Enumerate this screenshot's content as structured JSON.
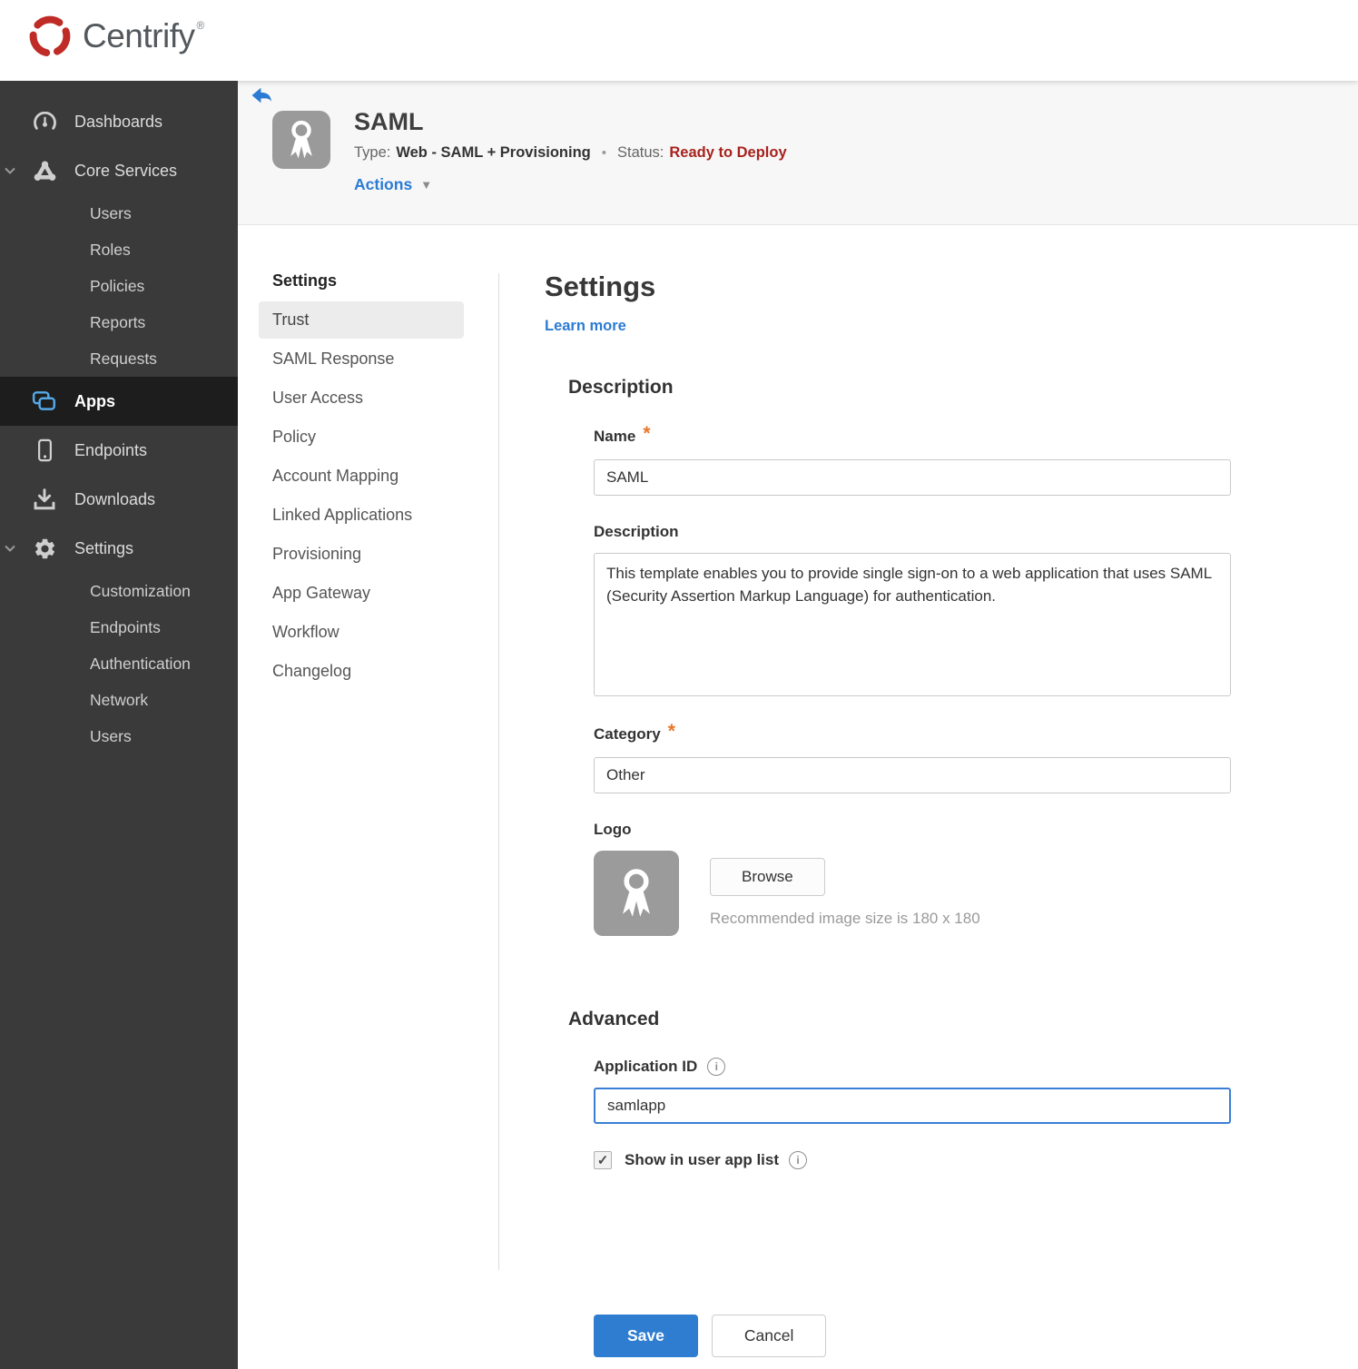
{
  "brand": {
    "name": "Centrify",
    "trademark": "®"
  },
  "colors": {
    "accent_blue": "#2b7bd3",
    "save_blue": "#2e7dd1",
    "status_red": "#a6231e",
    "required_orange": "#e8762b",
    "brand_red": "#bf2b26",
    "sidebar_bg": "#3a3a3a",
    "sidebar_active_bg": "#1d1d1d",
    "header_band_bg": "#f7f7f7",
    "subnav_active_bg": "#ececec"
  },
  "sidebar": {
    "items": [
      {
        "label": "Dashboards",
        "type": "top",
        "icon": "dashboard-gauge-icon"
      },
      {
        "label": "Core Services",
        "type": "top",
        "icon": "core-services-icon",
        "expanded": true
      },
      {
        "label": "Users",
        "type": "sub"
      },
      {
        "label": "Roles",
        "type": "sub"
      },
      {
        "label": "Policies",
        "type": "sub"
      },
      {
        "label": "Reports",
        "type": "sub"
      },
      {
        "label": "Requests",
        "type": "sub"
      },
      {
        "label": "Apps",
        "type": "top",
        "icon": "apps-icon",
        "active": true
      },
      {
        "label": "Endpoints",
        "type": "top",
        "icon": "endpoints-phone-icon"
      },
      {
        "label": "Downloads",
        "type": "top",
        "icon": "downloads-icon"
      },
      {
        "label": "Settings",
        "type": "top",
        "icon": "gear-icon",
        "expanded": true
      },
      {
        "label": "Customization",
        "type": "sub"
      },
      {
        "label": "Endpoints",
        "type": "sub"
      },
      {
        "label": "Authentication",
        "type": "sub"
      },
      {
        "label": "Network",
        "type": "sub"
      },
      {
        "label": "Users",
        "type": "sub"
      }
    ]
  },
  "app_header": {
    "title": "SAML",
    "type_label": "Type:",
    "type_value": "Web - SAML + Provisioning",
    "status_label": "Status:",
    "status_value": "Ready to Deploy",
    "actions_label": "Actions"
  },
  "subnav": {
    "header": "Settings",
    "active_item": "Trust",
    "items": [
      "Trust",
      "SAML Response",
      "User Access",
      "Policy",
      "Account Mapping",
      "Linked Applications",
      "Provisioning",
      "App Gateway",
      "Workflow",
      "Changelog"
    ]
  },
  "main": {
    "title": "Settings",
    "learn_more_label": "Learn more",
    "description": {
      "heading": "Description",
      "name_label": "Name",
      "name_required": true,
      "name_value": "SAML",
      "description_label": "Description",
      "description_value": "This template enables you to provide single sign-on to a web application that uses SAML (Security Assertion Markup Language) for authentication.",
      "category_label": "Category",
      "category_required": true,
      "category_value": "Other",
      "logo_label": "Logo",
      "browse_label": "Browse",
      "logo_hint": "Recommended image size is 180 x 180"
    },
    "advanced": {
      "heading": "Advanced",
      "application_id_label": "Application ID",
      "application_id_value": "samlapp",
      "show_in_user_app_list_label": "Show in user app list",
      "show_in_user_app_list_checked": true
    },
    "footer": {
      "save_label": "Save",
      "cancel_label": "Cancel"
    }
  }
}
